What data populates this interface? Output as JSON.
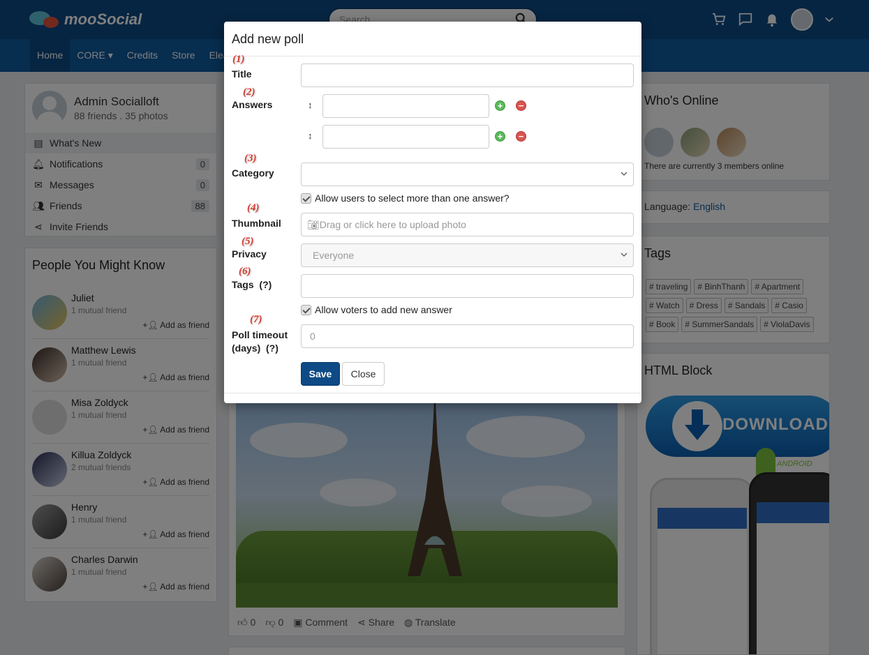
{
  "header": {
    "brand": "mooSocial",
    "search_placeholder": "Search",
    "nav": [
      "Home",
      "CORE ▾",
      "Credits",
      "Store",
      "Elea"
    ]
  },
  "profile": {
    "name": "Admin Socialloft",
    "stats": "88 friends . 35 photos",
    "menu": [
      {
        "label": "What's New",
        "badge": ""
      },
      {
        "label": "Notifications",
        "badge": "0"
      },
      {
        "label": "Messages",
        "badge": "0"
      },
      {
        "label": "Friends",
        "badge": "88"
      },
      {
        "label": "Invite Friends",
        "badge": ""
      }
    ]
  },
  "pymk": {
    "title": "People You Might Know",
    "add_label": "Add as friend",
    "people": [
      {
        "name": "Juliet",
        "mutual": "1 mutual friend"
      },
      {
        "name": "Matthew Lewis",
        "mutual": "1 mutual friend"
      },
      {
        "name": "Misa Zoldyck",
        "mutual": "1 mutual friend"
      },
      {
        "name": "Killua Zoldyck",
        "mutual": "2 mutual friends"
      },
      {
        "name": "Henry",
        "mutual": "1 mutual friend"
      },
      {
        "name": "Charles Darwin",
        "mutual": "1 mutual friend"
      }
    ]
  },
  "feed": {
    "likes": "0",
    "dislikes": "0",
    "comment": "Comment",
    "share": "Share",
    "translate": "Translate"
  },
  "right": {
    "online_title": "Who's Online",
    "online_text": "There are currently 3 members online",
    "language_label": "Language:",
    "language_value": "English",
    "tags_title": "Tags",
    "tags": [
      "# traveling",
      "# BinhThanh",
      "# Apartment",
      "# Watch",
      "# Dress",
      "# Sandals",
      "# Casio",
      "# Book",
      "# SummerSandals",
      "# ViolaDavis"
    ],
    "html_title": "HTML Block",
    "download_text": "DOWNLOAD",
    "android_text": "ANDROID"
  },
  "modal": {
    "title": "Add new poll",
    "numbers": [
      "(1)",
      "(2)",
      "(3)",
      "(4)",
      "(5)",
      "(6)",
      "(7)"
    ],
    "title_label": "Title",
    "answers_label": "Answers",
    "category_label": "Category",
    "multi_answer_label": "Allow users to select more than one answer?",
    "thumbnail_label": "Thumbnail",
    "thumbnail_placeholder": "Drag or click here to upload photo",
    "privacy_label": "Privacy",
    "privacy_value": "Everyone",
    "tags_label": "Tags",
    "tags_help": "(?)",
    "voters_add_label": "Allow voters to add new answer",
    "timeout_label_1": "Poll timeout",
    "timeout_label_2": "(days)",
    "timeout_help": "(?)",
    "timeout_value": "0",
    "save_label": "Save",
    "close_label": "Close"
  }
}
